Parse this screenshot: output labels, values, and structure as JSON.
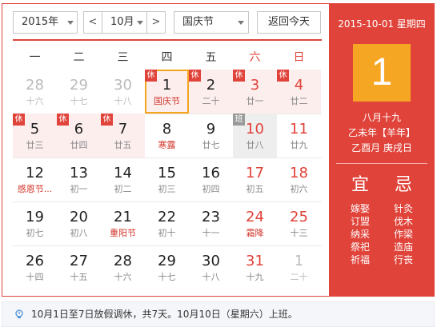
{
  "toolbar": {
    "year": "2015年",
    "prev": "<",
    "month": "10月",
    "next": ">",
    "holiday": "国庆节",
    "today": "返回今天"
  },
  "weekdays": [
    "一",
    "二",
    "三",
    "四",
    "五",
    "六",
    "日"
  ],
  "weeks": [
    [
      {
        "day": "28",
        "sub": "十六",
        "gray": true
      },
      {
        "day": "29",
        "sub": "十七",
        "gray": true
      },
      {
        "day": "30",
        "sub": "十八",
        "gray": true
      },
      {
        "day": "1",
        "sub": "国庆节",
        "badge": "休",
        "festival": true,
        "current": true
      },
      {
        "day": "2",
        "sub": "二十",
        "badge": "休"
      },
      {
        "day": "3",
        "sub": "廿一",
        "badge": "休"
      },
      {
        "day": "4",
        "sub": "廿二",
        "badge": "休"
      }
    ],
    [
      {
        "day": "5",
        "sub": "廿三",
        "badge": "休"
      },
      {
        "day": "6",
        "sub": "廿四",
        "badge": "休"
      },
      {
        "day": "7",
        "sub": "廿五",
        "badge": "休"
      },
      {
        "day": "8",
        "sub": "寒露",
        "festival": true
      },
      {
        "day": "9",
        "sub": "廿七"
      },
      {
        "day": "10",
        "sub": "廿八",
        "badge": "班"
      },
      {
        "day": "11",
        "sub": "廿九"
      }
    ],
    [
      {
        "day": "12",
        "sub": "感恩节...",
        "festival": true
      },
      {
        "day": "13",
        "sub": "初一"
      },
      {
        "day": "14",
        "sub": "初二"
      },
      {
        "day": "15",
        "sub": "初三"
      },
      {
        "day": "16",
        "sub": "初四"
      },
      {
        "day": "17",
        "sub": "初五"
      },
      {
        "day": "18",
        "sub": "初六"
      }
    ],
    [
      {
        "day": "19",
        "sub": "初七"
      },
      {
        "day": "20",
        "sub": "初八"
      },
      {
        "day": "21",
        "sub": "重阳节",
        "festival": true
      },
      {
        "day": "22",
        "sub": "初十"
      },
      {
        "day": "23",
        "sub": "十一"
      },
      {
        "day": "24",
        "sub": "霜降",
        "festival": true
      },
      {
        "day": "25",
        "sub": "十三"
      }
    ],
    [
      {
        "day": "26",
        "sub": "十四"
      },
      {
        "day": "27",
        "sub": "十五"
      },
      {
        "day": "28",
        "sub": "十六"
      },
      {
        "day": "29",
        "sub": "十七"
      },
      {
        "day": "30",
        "sub": "十八"
      },
      {
        "day": "31",
        "sub": "十九"
      },
      {
        "day": "1",
        "sub": "二十",
        "gray": true
      }
    ]
  ],
  "panel": {
    "date": "2015-10-01 星期四",
    "big_day": "1",
    "lunar_date": "八月十九",
    "year_ganzhi": "乙未年【羊年】",
    "month_day_ganzhi": "乙酉月 庚戌日",
    "yi_title": "宜",
    "ji_title": "忌",
    "yi": [
      "嫁娶",
      "订盟",
      "纳采",
      "祭祀",
      "祈福"
    ],
    "ji": [
      "针灸",
      "伐木",
      "作梁",
      "造庙",
      "行丧"
    ]
  },
  "footer": {
    "notice": "10月1日至7日放假调休，共7天。10月10日（星期六）上班。"
  },
  "colors": {
    "accent": "#e0433a",
    "today_box": "#f5a623",
    "current_border": "#f3a51d",
    "holiday_bg": "#fdeeee",
    "workday_bg": "#eeeeee"
  }
}
